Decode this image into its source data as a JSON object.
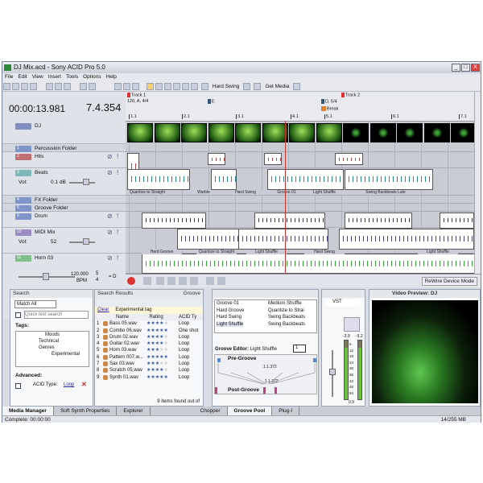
{
  "window": {
    "title": "DJ Mix.acd - Sony ACID Pro 5.0",
    "min": "_",
    "max": "□",
    "close": "X"
  },
  "menu": [
    "File",
    "Edit",
    "View",
    "Insert",
    "Tools",
    "Options",
    "Help"
  ],
  "toolbar": {
    "groove_select": "Hard Swing",
    "get_media": "Get Media"
  },
  "time": {
    "position": "00:00:13.981",
    "measure": "7.4.354"
  },
  "timeline": {
    "markers": [
      "Track 1",
      "Track 2"
    ],
    "tempo": "120, A, 4/4",
    "key_e": "E",
    "key_d": "D, 5/4",
    "region": "Break",
    "ruler": [
      "1.1",
      "2.1",
      "3.1",
      "4.1",
      "5.1",
      "6.1",
      "7.1"
    ]
  },
  "tracks": [
    {
      "num": "",
      "name": "DJ",
      "color": "#7f8ebf"
    },
    {
      "num": "1",
      "name": "Percussion Folder",
      "color": "#7f95c9"
    },
    {
      "num": "2",
      "name": "Hits",
      "color": "#c07070"
    },
    {
      "num": "3",
      "name": "Beats",
      "color": "#7fb8b8",
      "vol_label": "Vol:",
      "vol": "0.1 dB"
    },
    {
      "num": "4",
      "name": "FX Folder",
      "color": "#7f95c9"
    },
    {
      "num": "5",
      "name": "Groove Folder",
      "color": "#7f95c9"
    },
    {
      "num": "9",
      "name": "Drum",
      "color": "#7f95c9"
    },
    {
      "num": "10",
      "name": "MIDI Mix",
      "color": "#9a8cc4",
      "vol_label": "Vol:",
      "vol": "52"
    },
    {
      "num": "11",
      "name": "Horn 03",
      "color": "#7fbf8a"
    }
  ],
  "clip_labels": [
    "Quantize to Straight",
    "Warble",
    "Hard Swing",
    "Groove 01",
    "Light Shuffle",
    "Swing Backbeats Late",
    "Hard Groove",
    "Quantize to Straight",
    "Light Shuffle",
    "Hard Swing",
    "Light Shuffle"
  ],
  "tempo": {
    "bpm": "120.000",
    "bpm_label": "BPM",
    "ts_top": "5",
    "ts_bottom": "4",
    "key": "= D"
  },
  "transport": {
    "rewire": "ReWire Device Mode"
  },
  "search": {
    "title": "Search",
    "match": "Match All",
    "placeholder": "Quick text search",
    "tags_label": "Tags:",
    "tree": [
      "Moods",
      "Technical",
      "Genres",
      "Experimental"
    ],
    "advanced": "Advanced:",
    "acid_type_label": "ACID Type:",
    "acid_type": "Loop"
  },
  "results": {
    "title": "Search Results",
    "right": "Groove",
    "clear": "Clear",
    "tag": "Experimental tag",
    "cols": [
      "Name",
      "Rating",
      "ACID Ty"
    ],
    "rows": [
      {
        "n": "1",
        "name": "Bass 05.wav",
        "rating": 4,
        "type": "Loop"
      },
      {
        "n": "2",
        "name": "Combo 06.wav",
        "rating": 5,
        "type": "One shot"
      },
      {
        "n": "3",
        "name": "Drum 02.wav",
        "rating": 4,
        "type": "Loop"
      },
      {
        "n": "4",
        "name": "Guitar 02.wav",
        "rating": 4,
        "type": "Loop"
      },
      {
        "n": "5",
        "name": "Horn 03.wav",
        "rating": 3,
        "type": "Loop"
      },
      {
        "n": "6",
        "name": "Pattern 007.w...",
        "rating": 5,
        "type": "Loop"
      },
      {
        "n": "7",
        "name": "Sax 03.wav",
        "rating": 3,
        "type": "Loop"
      },
      {
        "n": "8",
        "name": "Scratch 05.wav",
        "rating": 4,
        "type": "Loop"
      },
      {
        "n": "9",
        "name": "Synth 01.wav",
        "rating": 5,
        "type": "Loop"
      }
    ],
    "footer": "9 items found out of"
  },
  "groove": {
    "items": [
      "Groove 01",
      "Hard Groove",
      "Hard Swing",
      "Light Shuffle",
      "Medium Shuffle",
      "Quantize to Strai",
      "Swing Backbeats",
      "Swing Backbeats"
    ],
    "editor_label": "Groove Editor:",
    "editor_value": "Light Shuffle",
    "strength": "1",
    "pre": "Pre-Groove",
    "post": "Post-Groove",
    "pos1": "1.1.372",
    "pos2": "1.1.372"
  },
  "mixer": {
    "vst": "VST",
    "peak_l": "-3.9",
    "peak_r": "-9.2",
    "scale": [
      "6",
      "12",
      "18",
      "24",
      "30",
      "36",
      "42",
      "48",
      "54"
    ],
    "bottom": "0.9"
  },
  "video": {
    "title": "Video Preview: DJ"
  },
  "tabs": [
    "Media Manager",
    "Soft Synth Properties",
    "Explorer",
    "Chopper",
    "Groove Pool",
    "Plug-I"
  ],
  "status": {
    "text": "Complete: 00:00:00",
    "memory": "14/255 MB"
  }
}
